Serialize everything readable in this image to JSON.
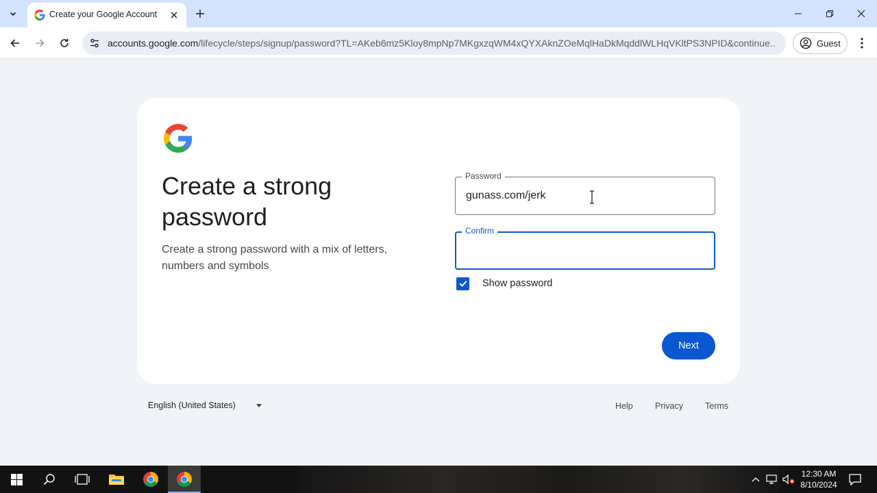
{
  "browser": {
    "tab": {
      "title": "Create your Google Account"
    },
    "url_host": "accounts.google.com",
    "url_path": "/lifecycle/steps/signup/password?TL=AKeb6mz5Kloy8mpNp7MKgxzqWM4xQYXAknZOeMqlHaDkMqddlWLHqVKltPS3NPID&continue...",
    "profile_label": "Guest"
  },
  "page": {
    "heading": "Create a strong password",
    "subtext": "Create a strong password with a mix of letters, numbers and symbols",
    "password": {
      "label": "Password",
      "value": "gunass.com/jerk"
    },
    "confirm": {
      "label": "Confirm",
      "value": ""
    },
    "show_password": {
      "label": "Show password",
      "checked": true
    },
    "next_label": "Next"
  },
  "footer": {
    "language": "English (United States)",
    "links": [
      "Help",
      "Privacy",
      "Terms"
    ]
  },
  "taskbar": {
    "time": "12:30 AM",
    "date": "8/10/2024"
  },
  "colors": {
    "primary_blue": "#0b57d0",
    "page_bg": "#f0f4f9",
    "tabstrip_bg": "#d3e3fd"
  }
}
